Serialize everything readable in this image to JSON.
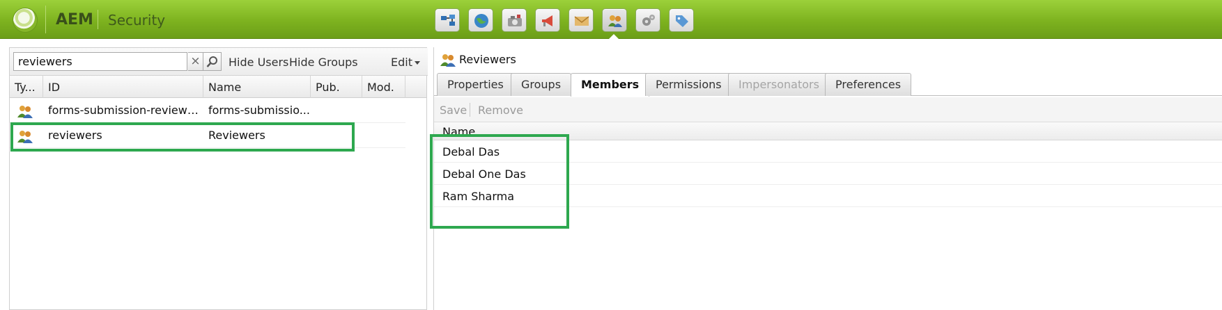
{
  "app": {
    "brand": "AEM",
    "section": "Security"
  },
  "colors": {
    "header_green": "#86bb23",
    "highlight": "#2ea84f",
    "disabled_text": "#a5a5a5"
  },
  "toolbar_icons": [
    "sites-icon",
    "globe-icon",
    "camera-icon",
    "megaphone-icon",
    "mail-icon",
    "users-icon",
    "gear-icon",
    "tag-icon"
  ],
  "search": {
    "value": "reviewers",
    "clear_label": "×"
  },
  "left_toolbar": {
    "hide_users": "Hide Users",
    "hide_groups": "Hide Groups",
    "edit": "Edit"
  },
  "grid": {
    "columns": [
      "Ty...",
      "ID",
      "Name",
      "Pub.",
      "Mod."
    ],
    "rows": [
      {
        "type_icon": "group-icon",
        "id": "forms-submission-reviewers",
        "name": "forms-submissio..."
      },
      {
        "type_icon": "group-icon",
        "id": "reviewers",
        "name": "Reviewers"
      }
    ]
  },
  "detail": {
    "title": "Reviewers",
    "tabs": [
      {
        "label": "Properties",
        "state": "normal"
      },
      {
        "label": "Groups",
        "state": "normal"
      },
      {
        "label": "Members",
        "state": "active"
      },
      {
        "label": "Permissions",
        "state": "normal"
      },
      {
        "label": "Impersonators",
        "state": "disabled"
      },
      {
        "label": "Preferences",
        "state": "normal"
      }
    ],
    "actions": {
      "save": "Save",
      "remove": "Remove"
    },
    "members_header": "Name",
    "members": [
      "Debal Das",
      "Debal One Das",
      "Ram Sharma"
    ]
  }
}
